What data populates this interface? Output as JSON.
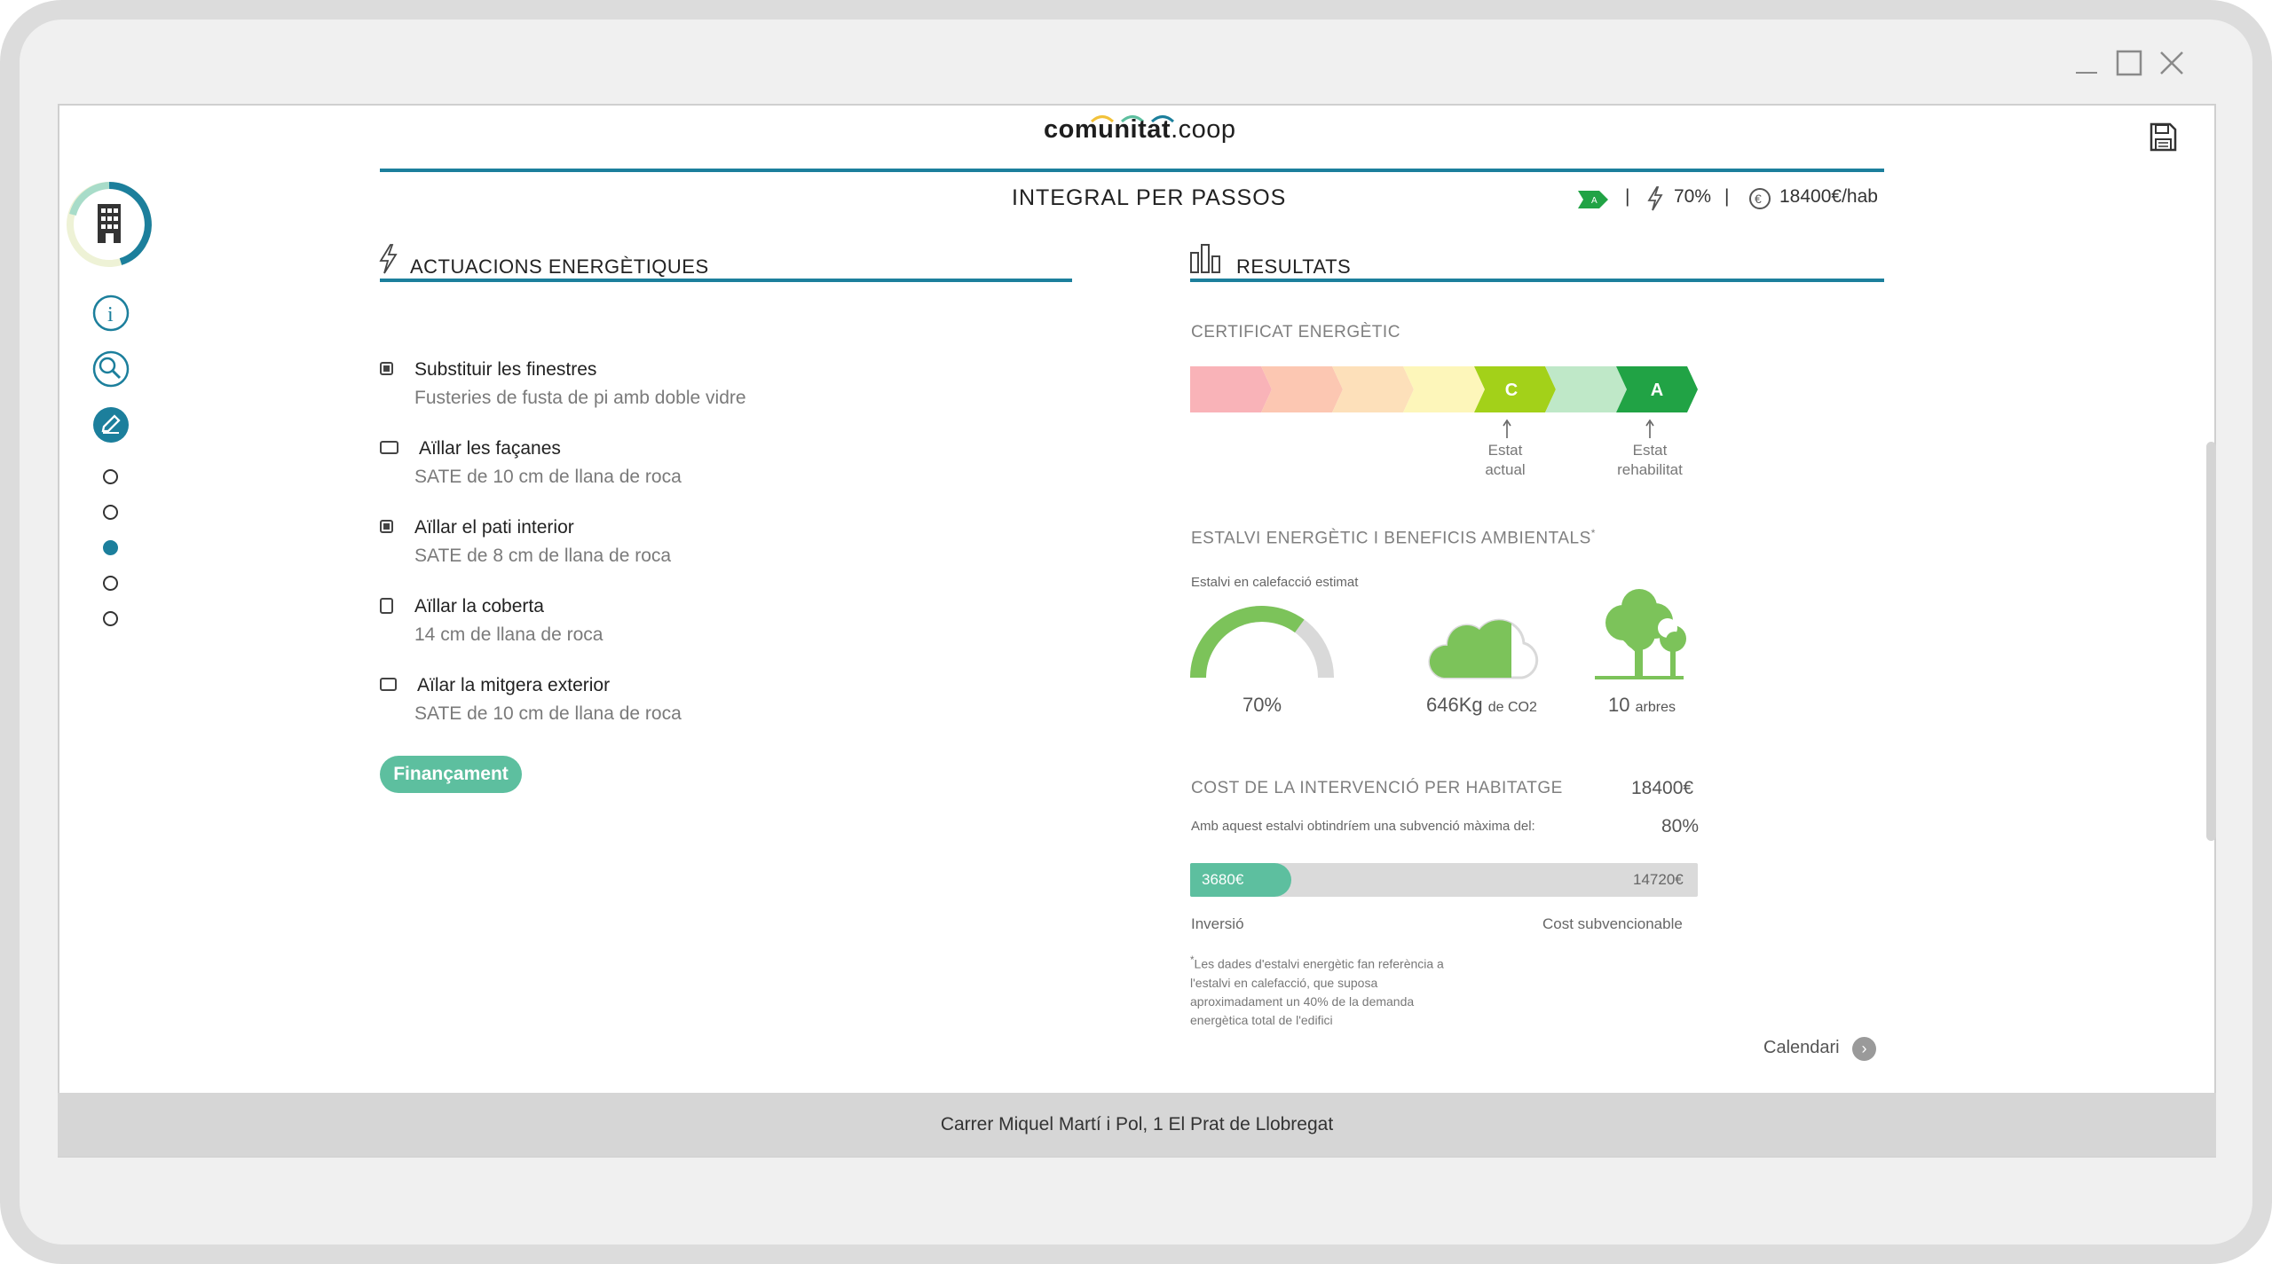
{
  "app": {
    "logo_main": "comunitat",
    "logo_ext": ".coop",
    "save_icon": "floppy-disk-icon"
  },
  "header": {
    "title": "INTEGRAL PER PASSOS",
    "energy_badge": "A",
    "savings": "70%",
    "cost_per_home": "18400€/hab",
    "separator": "|"
  },
  "sidebar": {
    "items": [
      {
        "name": "building-icon"
      },
      {
        "name": "info-icon",
        "glyph": "i"
      },
      {
        "name": "search-icon"
      },
      {
        "name": "edit-icon"
      }
    ],
    "steps": [
      {
        "active": false
      },
      {
        "active": false
      },
      {
        "active": true
      },
      {
        "active": false
      },
      {
        "active": false
      }
    ]
  },
  "actions": {
    "heading": "ACTUACIONS ENERGÈTIQUES",
    "items": [
      {
        "title": "Substituir les finestres",
        "detail": "Fusteries de fusta de pi amb doble vidre",
        "checked": true
      },
      {
        "title": "Aïllar les façanes",
        "detail": "SATE de 10 cm de llana de roca",
        "checked": false
      },
      {
        "title": "Aïllar el pati interior",
        "detail": "SATE de 8 cm de llana de roca",
        "checked": true
      },
      {
        "title": "Aïllar la coberta",
        "detail": "14 cm de llana de roca",
        "checked": false
      },
      {
        "title": "Aïlar la mitgera exterior",
        "detail": "SATE de 10 cm de llana de roca",
        "checked": false
      }
    ],
    "financing_button": "Finançament"
  },
  "results": {
    "heading": "RESULTATS",
    "certificate_label": "CERTIFICAT ENERGÈTIC",
    "current_class": "C",
    "target_class": "A",
    "current_label_1": "Estat",
    "current_label_2": "actual",
    "target_label_1": "Estat",
    "target_label_2": "rehabilitat",
    "arrow_colors": [
      "#f9b3b8",
      "#fcc7b2",
      "#fde0ba",
      "#fdf6ba",
      "#a3d119",
      "#bfe8c8",
      "#21a345"
    ],
    "savings_heading": "ESTALVI ENERGÈTIC I BENEFICIS AMBIENTALS",
    "savings_heading_mark": "*",
    "heating_label": "Estalvi en calefacció estimat",
    "heating_savings": 0.7,
    "heating_value": "70%",
    "co2_value": "646Kg",
    "co2_unit": "de CO2",
    "trees_value": "10",
    "trees_unit": "arbres",
    "cost_heading": "COST DE LA INTERVENCIÓ PER HABITATGE",
    "cost_value": "18400€",
    "subsidy_text": "Amb aquest estalvi obtindríem una subvenció màxima del:",
    "subsidy_value": "80%",
    "investment_amount": "3680€",
    "subsidized_amount": "14720€",
    "investment_fraction": 0.2,
    "investment_label": "Inversió",
    "subsidized_label": "Cost subvencionable",
    "footnote_mark": "*",
    "footnote": "Les dades d'estalvi energètic fan referència a l'estalvi en calefacció, que suposa aproximadament un 40% de la demanda energètica total de l'edifici",
    "calendar_link": "Calendari",
    "calendar_arrow": "›"
  },
  "footer": {
    "address": "Carrer Miquel Martí i Pol, 1 El Prat de Llobregat"
  },
  "colors": {
    "accent": "#1c7f9c",
    "green": "#5dbf9f",
    "leaf": "#7cc35a"
  }
}
